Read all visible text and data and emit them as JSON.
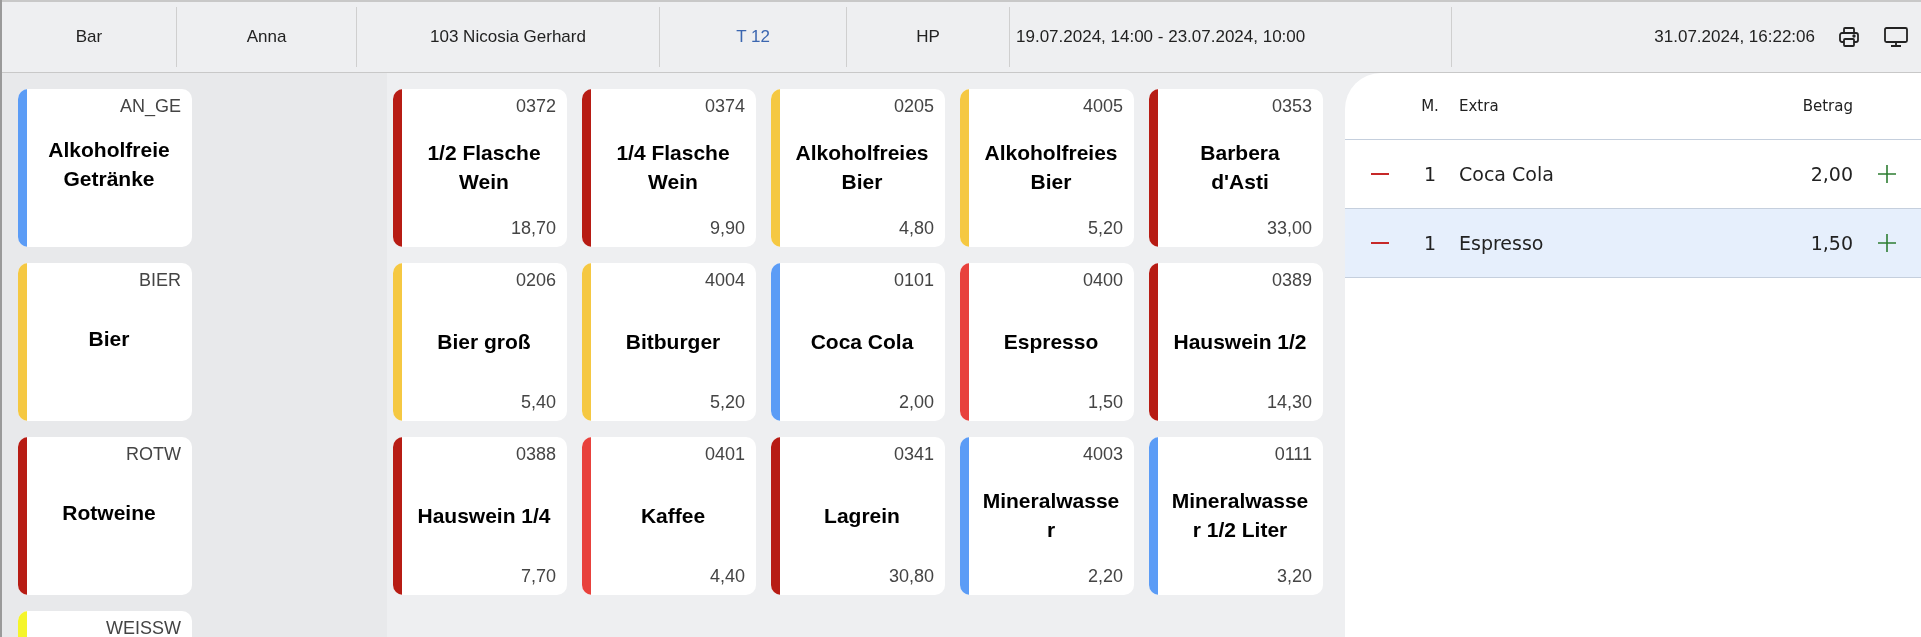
{
  "header": {
    "cells": [
      {
        "text": "Bar",
        "kind": "plain"
      },
      {
        "text": "Anna",
        "kind": "plain"
      },
      {
        "text": "103 Nicosia Gerhard",
        "kind": "plain"
      },
      {
        "text": "T 12",
        "kind": "link"
      },
      {
        "text": "HP",
        "kind": "plain"
      },
      {
        "text": "19.07.2024, 14:00 - 23.07.2024, 10:00",
        "kind": "left"
      }
    ],
    "datetime": "31.07.2024, 16:22:06"
  },
  "categories": [
    {
      "code": "AN_GE",
      "name": "Alkoholfreie Getränke",
      "color": "#5b9cf6"
    },
    {
      "code": "BIER",
      "name": "Bier",
      "color": "#f5c842"
    },
    {
      "code": "ROTW",
      "name": "Rotweine",
      "color": "#b71c14"
    },
    {
      "code": "WEISSW",
      "color": "#f5f52a"
    }
  ],
  "products": [
    {
      "code": "0372",
      "name": "1/2 Flasche Wein",
      "price": "18,70",
      "color": "#b71c14"
    },
    {
      "code": "0374",
      "name": "1/4 Flasche Wein",
      "price": "9,90",
      "color": "#b71c14"
    },
    {
      "code": "0205",
      "name": "Alkoholfreies Bier",
      "price": "4,80",
      "color": "#f5c842"
    },
    {
      "code": "4005",
      "name": "Alkoholfreies Bier",
      "price": "5,20",
      "color": "#f5c842"
    },
    {
      "code": "0353",
      "name": "Barbera d'Asti",
      "price": "33,00",
      "color": "#b71c14"
    },
    {
      "code": "0206",
      "name": "Bier groß",
      "price": "5,40",
      "color": "#f5c842"
    },
    {
      "code": "4004",
      "name": "Bitburger",
      "price": "5,20",
      "color": "#f5c842"
    },
    {
      "code": "0101",
      "name": "Coca Cola",
      "price": "2,00",
      "color": "#5b9cf6"
    },
    {
      "code": "0400",
      "name": "Espresso",
      "price": "1,50",
      "color": "#e8413c"
    },
    {
      "code": "0389",
      "name": "Hauswein 1/2",
      "price": "14,30",
      "color": "#b71c14"
    },
    {
      "code": "0388",
      "name": "Hauswein 1/4",
      "price": "7,70",
      "color": "#b71c14"
    },
    {
      "code": "0401",
      "name": "Kaffee",
      "price": "4,40",
      "color": "#e8413c"
    },
    {
      "code": "0341",
      "name": "Lagrein",
      "price": "30,80",
      "color": "#b71c14"
    },
    {
      "code": "4003",
      "name": "Mineralwasser",
      "price": "2,20",
      "color": "#5b9cf6"
    },
    {
      "code": "0111",
      "name": "Mineralwasser 1/2 Liter",
      "price": "3,20",
      "color": "#5b9cf6"
    }
  ],
  "order": {
    "columns": [
      "M.",
      "Extra",
      "Betrag"
    ],
    "rows": [
      {
        "qty": "1",
        "name": "Coca Cola",
        "amount": "2,00",
        "selected": false
      },
      {
        "qty": "1",
        "name": "Espresso",
        "amount": "1,50",
        "selected": true
      }
    ]
  }
}
